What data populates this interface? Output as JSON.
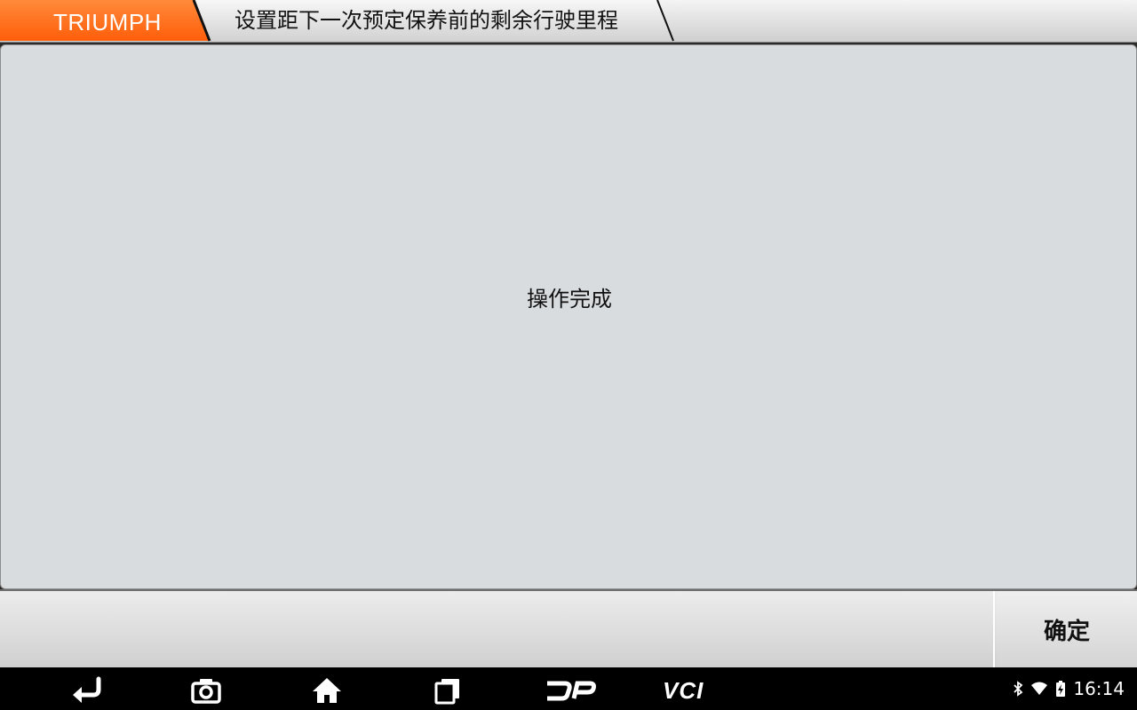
{
  "header": {
    "brand": "TRIUMPH",
    "breadcrumb": "设置距下一次预定保养前的剩余行驶里程"
  },
  "main": {
    "message": "操作完成"
  },
  "actions": {
    "confirm_label": "确定"
  },
  "navbar": {
    "buttons": [
      "back-icon",
      "camera-icon",
      "home-icon",
      "recent-apps-icon",
      "dp-icon",
      "vci-icon"
    ],
    "dp_label": "DP",
    "vci_label": "VCI"
  },
  "status": {
    "icons": [
      "bluetooth-icon",
      "wifi-icon",
      "battery-icon"
    ],
    "time": "16:14"
  },
  "colors": {
    "brand_orange": "#ff6a13",
    "panel_bg": "#d9dcdf",
    "navbar_bg": "#000000"
  }
}
